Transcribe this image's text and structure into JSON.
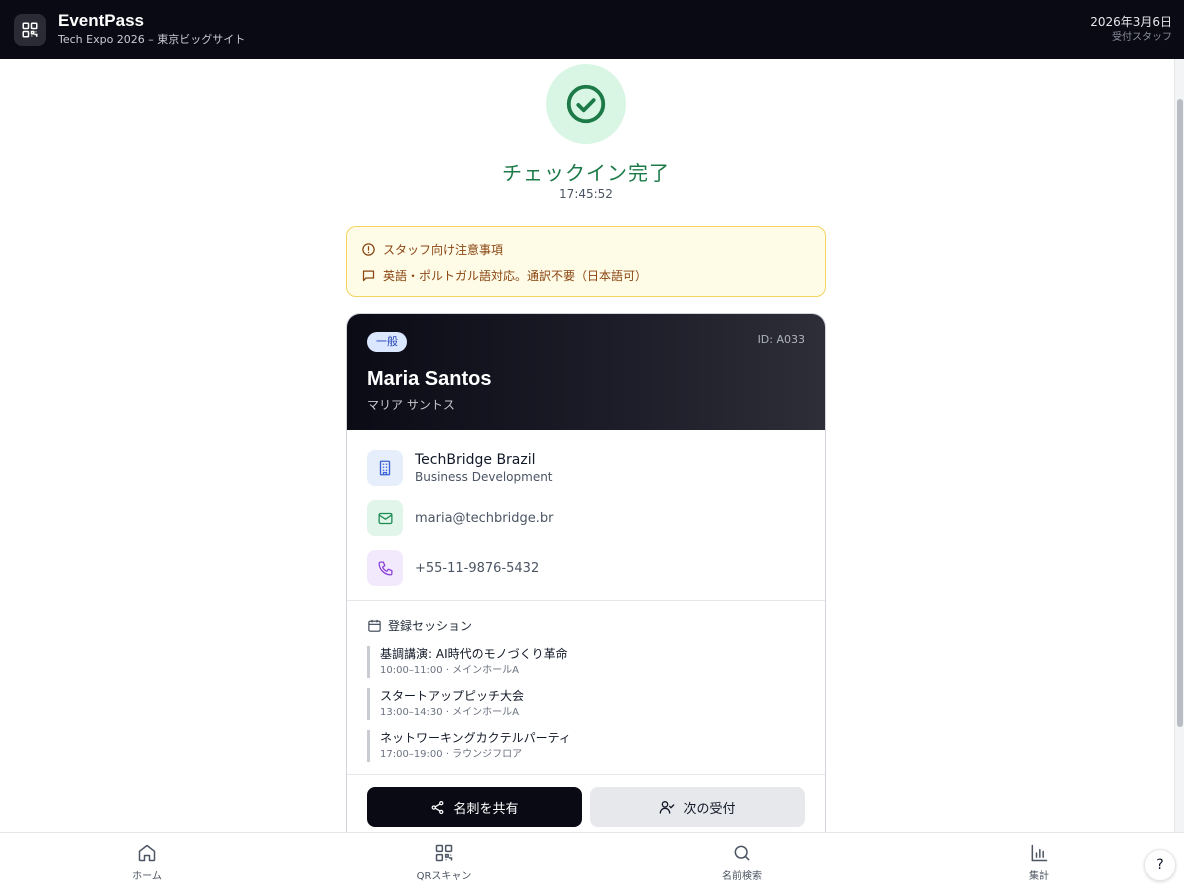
{
  "header": {
    "app_name": "EventPass",
    "event_name": "Tech Expo 2026 – 東京ビッグサイト",
    "date": "2026年3月6日",
    "role": "受付スタッフ",
    "logo_icon": "qr-code-icon"
  },
  "checkin": {
    "status_title": "チェックイン完了",
    "time": "17:45:52",
    "status_icon": "check-circle-icon",
    "status_color": "#1c7a48"
  },
  "staff_notice": {
    "title": "スタッフ向け注意事項",
    "note": "英語・ポルトガル語対応。通訳不要（日本語可）",
    "title_icon": "alert-circle-icon",
    "note_icon": "message-icon"
  },
  "attendee": {
    "category": "一般",
    "id_label": "ID: A033",
    "name": "Maria Santos",
    "name_kana": "マリア サントス",
    "company": "TechBridge Brazil",
    "department": "Business Development",
    "email": "maria@techbridge.br",
    "phone": "+55-11-9876-5432"
  },
  "sessions": {
    "heading": "登録セッション",
    "items": [
      {
        "title": "基調講演: AI時代のモノづくり革命",
        "meta": "10:00–11:00 · メインホールA"
      },
      {
        "title": "スタートアップピッチ大会",
        "meta": "13:00–14:30 · メインホールA"
      },
      {
        "title": "ネットワーキングカクテルパーティ",
        "meta": "17:00–19:00 · ラウンジフロア"
      }
    ]
  },
  "actions": {
    "share_label": "名刺を共有",
    "next_label": "次の受付"
  },
  "nav": {
    "home": "ホーム",
    "qr_scan": "QRスキャン",
    "name_search": "名前検索",
    "stats": "集計"
  },
  "help_label": "?"
}
